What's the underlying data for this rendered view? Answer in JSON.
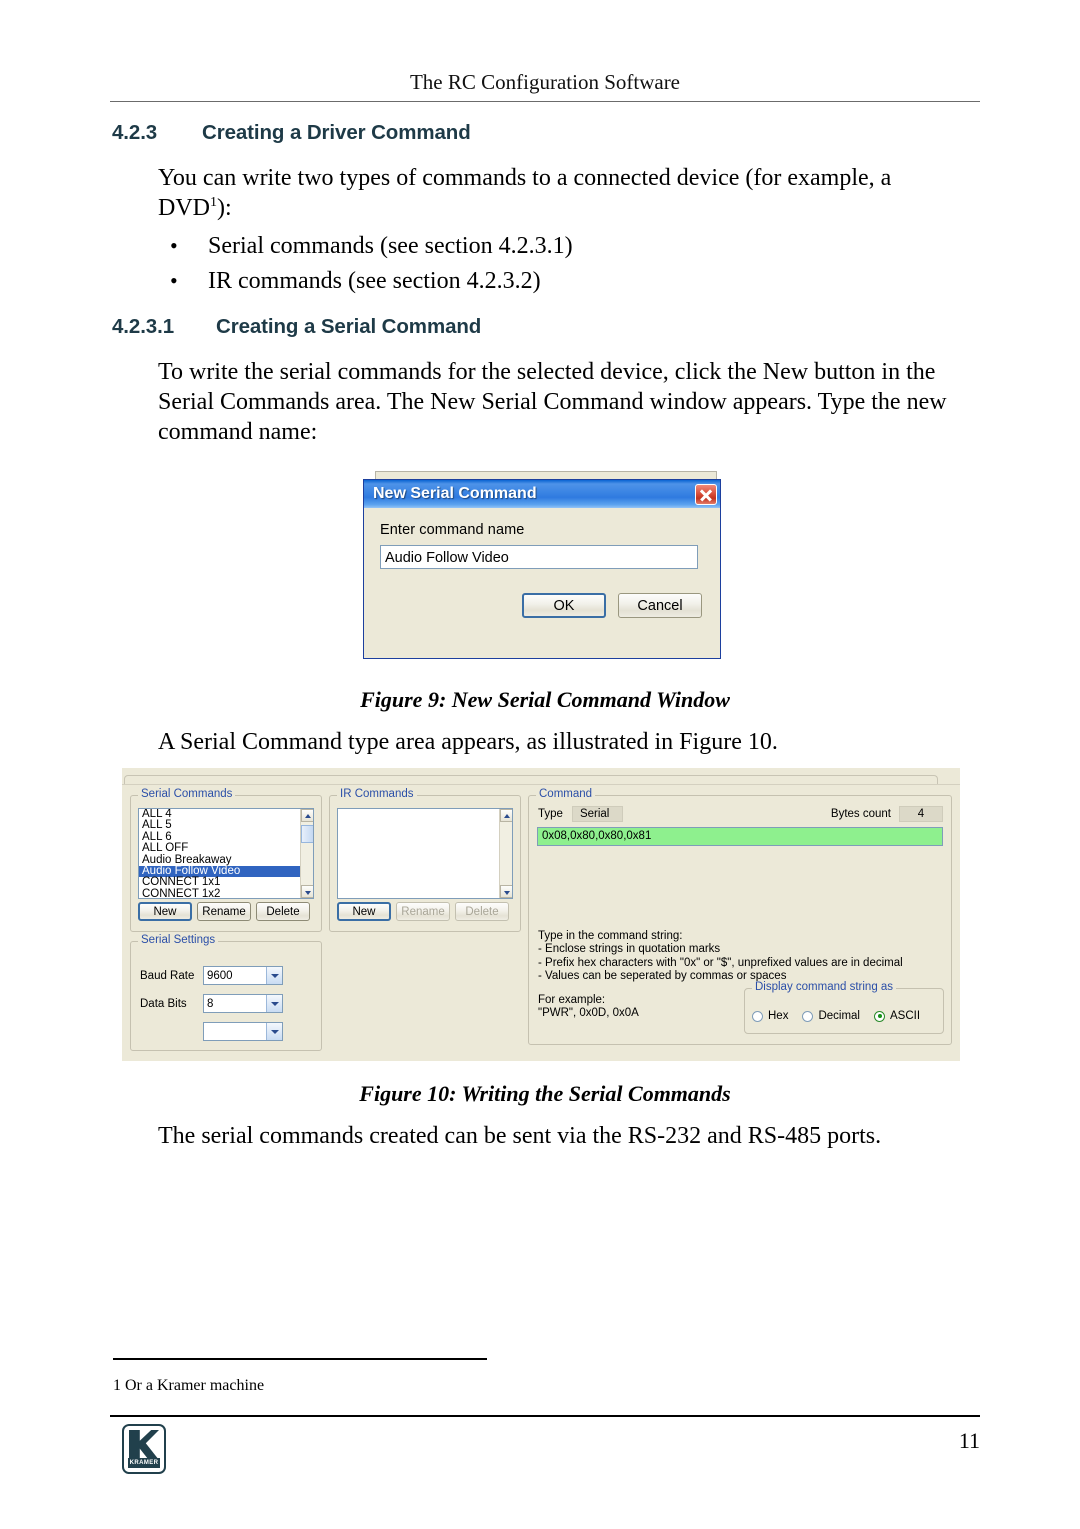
{
  "header": {
    "running_title": "The RC Configuration Software"
  },
  "sections": {
    "driver_command": {
      "number": "4.2.3",
      "title": "Creating a Driver Command",
      "intro_before_sup": "You can write two types of commands to a connected device (for example, a DVD",
      "intro_sup": "1",
      "intro_after_sup": "):",
      "bullets": [
        "Serial commands (see section 4.2.3.1)",
        "IR commands (see section 4.2.3.2)"
      ]
    },
    "serial_command": {
      "number": "4.2.3.1",
      "title": "Creating a Serial Command",
      "paragraph": "To write the serial commands for the selected device, click the New button in the Serial Commands area. The New Serial Command window appears. Type the new command name:"
    }
  },
  "figure9": {
    "caption": "Figure 9: New Serial Command Window",
    "dialog": {
      "title": "New Serial Command",
      "close_icon": "close-icon",
      "prompt_label": "Enter command name",
      "input_value": "Audio Follow Video",
      "ok_label": "OK",
      "cancel_label": "Cancel"
    }
  },
  "between_figures": {
    "paragraph": "A Serial Command type area appears, as illustrated in Figure 10."
  },
  "figure10": {
    "caption": "Figure 10: Writing the Serial Commands",
    "serial_commands": {
      "legend": "Serial Commands",
      "items": [
        "ALL 4",
        "ALL 5",
        "ALL 6",
        "ALL OFF",
        "Audio Breakaway",
        "Audio Follow Video",
        "CONNECT 1x1",
        "CONNECT 1x2"
      ],
      "selected_item": "Audio Follow Video",
      "buttons": {
        "new": "New",
        "rename": "Rename",
        "delete": "Delete"
      }
    },
    "ir_commands": {
      "legend": "IR Commands",
      "items": [],
      "buttons": {
        "new": "New",
        "rename": "Rename",
        "delete": "Delete"
      }
    },
    "serial_settings": {
      "legend": "Serial Settings",
      "rows": [
        {
          "label": "Baud Rate",
          "value": "9600"
        },
        {
          "label": "Data Bits",
          "value": "8"
        }
      ]
    },
    "command": {
      "legend": "Command",
      "type_label": "Type",
      "type_value": "Serial",
      "bytes_count_label": "Bytes count",
      "bytes_count_value": "4",
      "command_string": "0x08,0x80,0x80,0x81",
      "command_string_color": "#8ef08e",
      "help_lines": [
        "Type in the command string:",
        "- Enclose strings in quotation marks",
        "- Prefix hex characters with \"0x\" or \"$\", unprefixed values are in decimal",
        "- Values can be seperated by commas or spaces"
      ],
      "example_lines": [
        "For example:",
        "\"PWR\", 0x0D, 0x0A"
      ],
      "display_group": {
        "legend": "Display command string as",
        "options": [
          "Hex",
          "Decimal",
          "ASCII"
        ],
        "selected": "ASCII"
      }
    }
  },
  "closing": {
    "paragraph": "The serial commands created can be sent via the RS-232 and RS-485 ports."
  },
  "footer": {
    "footnote": "1 Or a Kramer machine",
    "logo_word": "KRAMER",
    "page_number": "11"
  },
  "colors": {
    "heading": "#1e3a47",
    "group_legend": "#2b4fa8",
    "selection": "#3064c0",
    "dialog_title_bar": "#2f7ae0",
    "command_string_bg": "#8ef08e"
  }
}
